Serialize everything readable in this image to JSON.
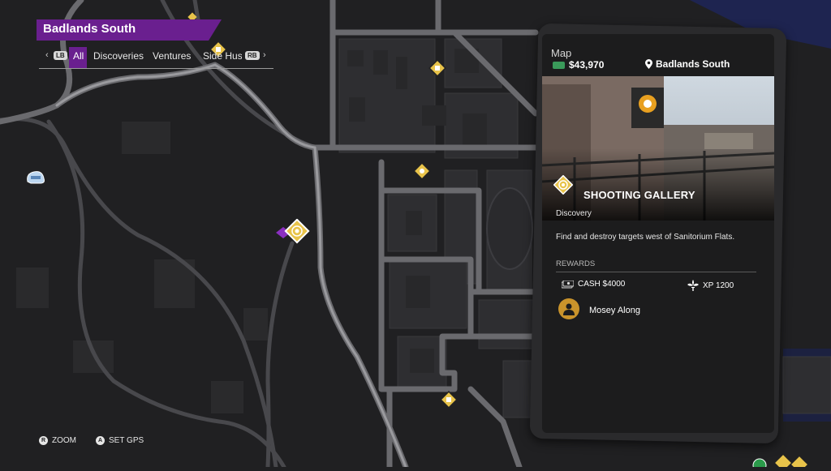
{
  "header": {
    "region": "Badlands South",
    "bumper_left": "LB",
    "bumper_right": "RB",
    "filters": [
      "All",
      "Discoveries",
      "Ventures",
      "Side Hus"
    ],
    "active_filter": "All"
  },
  "controls": [
    {
      "button": "R",
      "label": "ZOOM"
    },
    {
      "button": "A",
      "label": "SET GPS"
    }
  ],
  "phone": {
    "title": "Map",
    "cash": "$43,970",
    "location": "Badlands South",
    "activity": {
      "name": "SHOOTING GALLERY",
      "type": "Discovery",
      "description": "Find and destroy targets west of Sanitorium Flats.",
      "icon": "target-icon"
    },
    "rewards_label": "REWARDS",
    "rewards": [
      {
        "icon": "cash-icon",
        "label": "CASH $4000"
      },
      {
        "icon": "fleur-de-lis-icon",
        "label": "XP 1200"
      }
    ],
    "mission": "Mosey Along"
  },
  "colors": {
    "accent_purple": "#6a1f8f",
    "marker_gold": "#e8c34a",
    "road": "#5a5a5e",
    "water": "#1c2140",
    "map_bg": "#202022"
  }
}
